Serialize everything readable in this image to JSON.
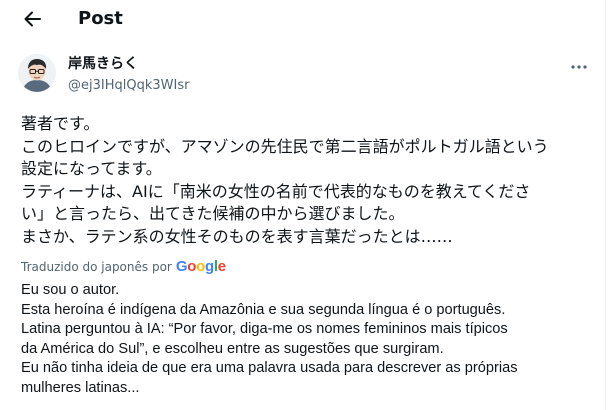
{
  "header": {
    "title": "Post"
  },
  "author": {
    "name": "岸馬きらく",
    "handle": "@ej3IHqlQqk3WIsr"
  },
  "post": {
    "original_lines": [
      "著者です。",
      "このヒロインですが、アマゾンの先住民で第二言語がポルトガル語という",
      "設定になってます。",
      "ラティーナは、AIに「南米の女性の名前で代表的なものを教えてくださ",
      "い」と言ったら、出てきた候補の中から選びました。",
      "まさか、ラテン系の女性そのものを表す言葉だったとは……"
    ],
    "translation_label": "Traduzido do japonês por",
    "translation_brand": "Google",
    "translated_lines": [
      "Eu sou o autor.",
      "Esta heroína é indígena da Amazônia e sua segunda língua é o português.",
      "Latina perguntou à IA: “Por favor, diga-me os nomes femininos mais típicos",
      "da América do Sul”, e escolheu entre as sugestões que surgiram.",
      "Eu não tinha ideia de que era uma palavra usada para descrever as próprias",
      "mulheres latinas..."
    ]
  },
  "icons": {
    "back": "arrow-left-icon",
    "more": "more-horizontal-icon"
  },
  "colors": {
    "text": "#0f1419",
    "secondary": "#536471",
    "google_blue": "#4285F4",
    "google_red": "#EA4335",
    "google_yellow": "#FBBC05",
    "google_green": "#34A853"
  }
}
